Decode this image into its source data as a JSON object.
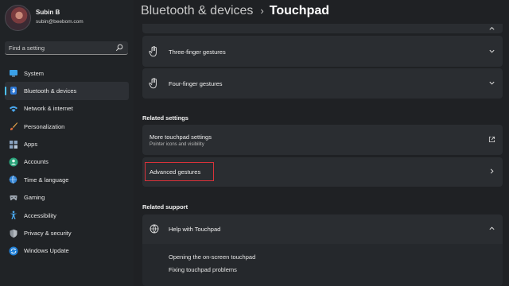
{
  "profile": {
    "name": "Subin B",
    "email": "subin@beebom.com"
  },
  "search": {
    "placeholder": "Find a setting"
  },
  "sidebar": {
    "items": [
      {
        "label": "System"
      },
      {
        "label": "Bluetooth & devices"
      },
      {
        "label": "Network & internet"
      },
      {
        "label": "Personalization"
      },
      {
        "label": "Apps"
      },
      {
        "label": "Accounts"
      },
      {
        "label": "Time & language"
      },
      {
        "label": "Gaming"
      },
      {
        "label": "Accessibility"
      },
      {
        "label": "Privacy & security"
      },
      {
        "label": "Windows Update"
      }
    ]
  },
  "breadcrumb": {
    "parent": "Bluetooth & devices",
    "separator": "›",
    "current": "Touchpad"
  },
  "gestures": {
    "three_finger": "Three-finger gestures",
    "four_finger": "Four-finger gestures"
  },
  "related_settings": {
    "heading": "Related settings",
    "more_touchpad": {
      "title": "More touchpad settings",
      "subtitle": "Pointer icons and visibility"
    },
    "advanced_gestures": "Advanced gestures"
  },
  "related_support": {
    "heading": "Related support",
    "help_title": "Help with Touchpad",
    "links": [
      "Opening the on-screen touchpad",
      "Fixing touchpad problems"
    ]
  },
  "colors": {
    "accent": "#4cc2ff",
    "highlight_box": "#d9323a"
  }
}
